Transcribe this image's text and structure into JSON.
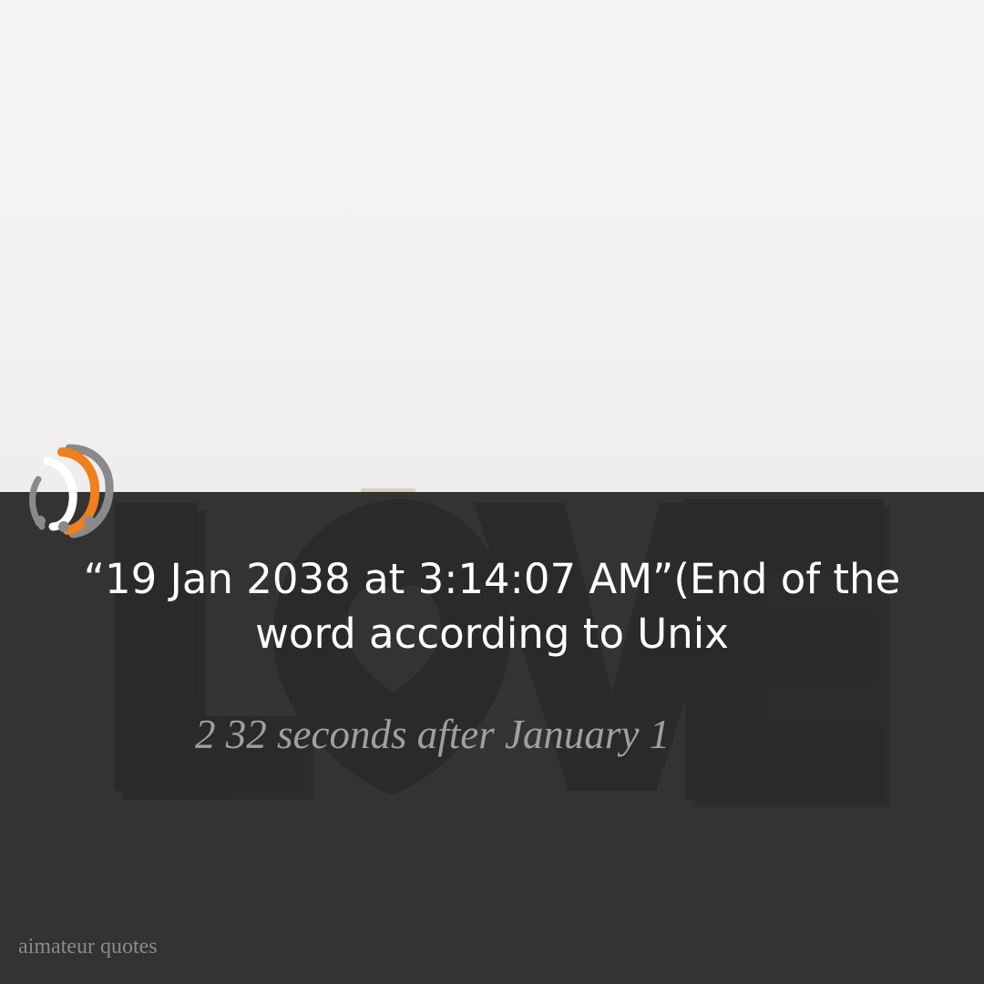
{
  "quote": {
    "main_text": "“19 Jan 2038 at 3:14:07 AM”(End of the word according to Unix",
    "sub_text": "2 32 seconds after January 1"
  },
  "background": {
    "sign_word": "LOVE",
    "colors": {
      "top_wall": "#f2f2f2",
      "overlay": "#333333",
      "letters": "#2b2b2b"
    }
  },
  "brand": {
    "watermark": "aimateur quotes",
    "logo_icon": "orange-gray-orbit-logo-icon",
    "colors": {
      "orange": "#f07f1c",
      "gray": "#8a8a8a"
    }
  }
}
